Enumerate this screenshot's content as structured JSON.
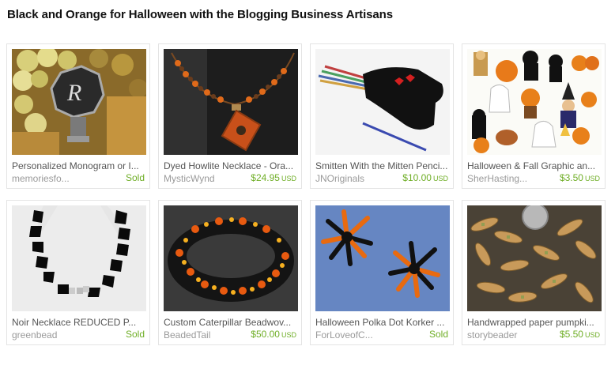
{
  "header": {
    "title": "Black and Orange for Halloween with the Blogging Business Artisans"
  },
  "colors": {
    "price_green": "#6fae26",
    "shop_gray": "#9a9a9a",
    "name_gray": "#555555",
    "border": "#e4e4e4"
  },
  "items": [
    {
      "name": "Personalized Monogram or I...",
      "shop": "memoriesfo...",
      "price": "",
      "currency": "",
      "sold": "Sold",
      "image": "monogram-wine-stopper-image"
    },
    {
      "name": "Dyed Howlite Necklace - Ora...",
      "shop": "MysticWynd",
      "price": "$24.95",
      "currency": "USD",
      "sold": "",
      "image": "howlite-necklace-image"
    },
    {
      "name": "Smitten With the Mitten Penci...",
      "shop": "JNOriginals",
      "price": "$10.00",
      "currency": "USD",
      "sold": "",
      "image": "mitten-pencil-case-image"
    },
    {
      "name": "Halloween & Fall Graphic an...",
      "shop": "SherHasting...",
      "price": "$3.50",
      "currency": "USD",
      "sold": "",
      "image": "halloween-graphics-image"
    },
    {
      "name": "Noir Necklace REDUCED P...",
      "shop": "greenbead",
      "price": "",
      "currency": "",
      "sold": "Sold",
      "image": "noir-necklace-image"
    },
    {
      "name": "Custom Caterpillar Beadwov...",
      "shop": "BeadedTail",
      "price": "$50.00",
      "currency": "USD",
      "sold": "",
      "image": "caterpillar-bracelet-image"
    },
    {
      "name": "Halloween Polka Dot Korker ...",
      "shop": "ForLoveofC...",
      "price": "",
      "currency": "",
      "sold": "Sold",
      "image": "korker-bows-image"
    },
    {
      "name": "Handwrapped paper pumpki...",
      "shop": "storybeader",
      "price": "$5.50",
      "currency": "USD",
      "sold": "",
      "image": "paper-beads-image"
    }
  ]
}
